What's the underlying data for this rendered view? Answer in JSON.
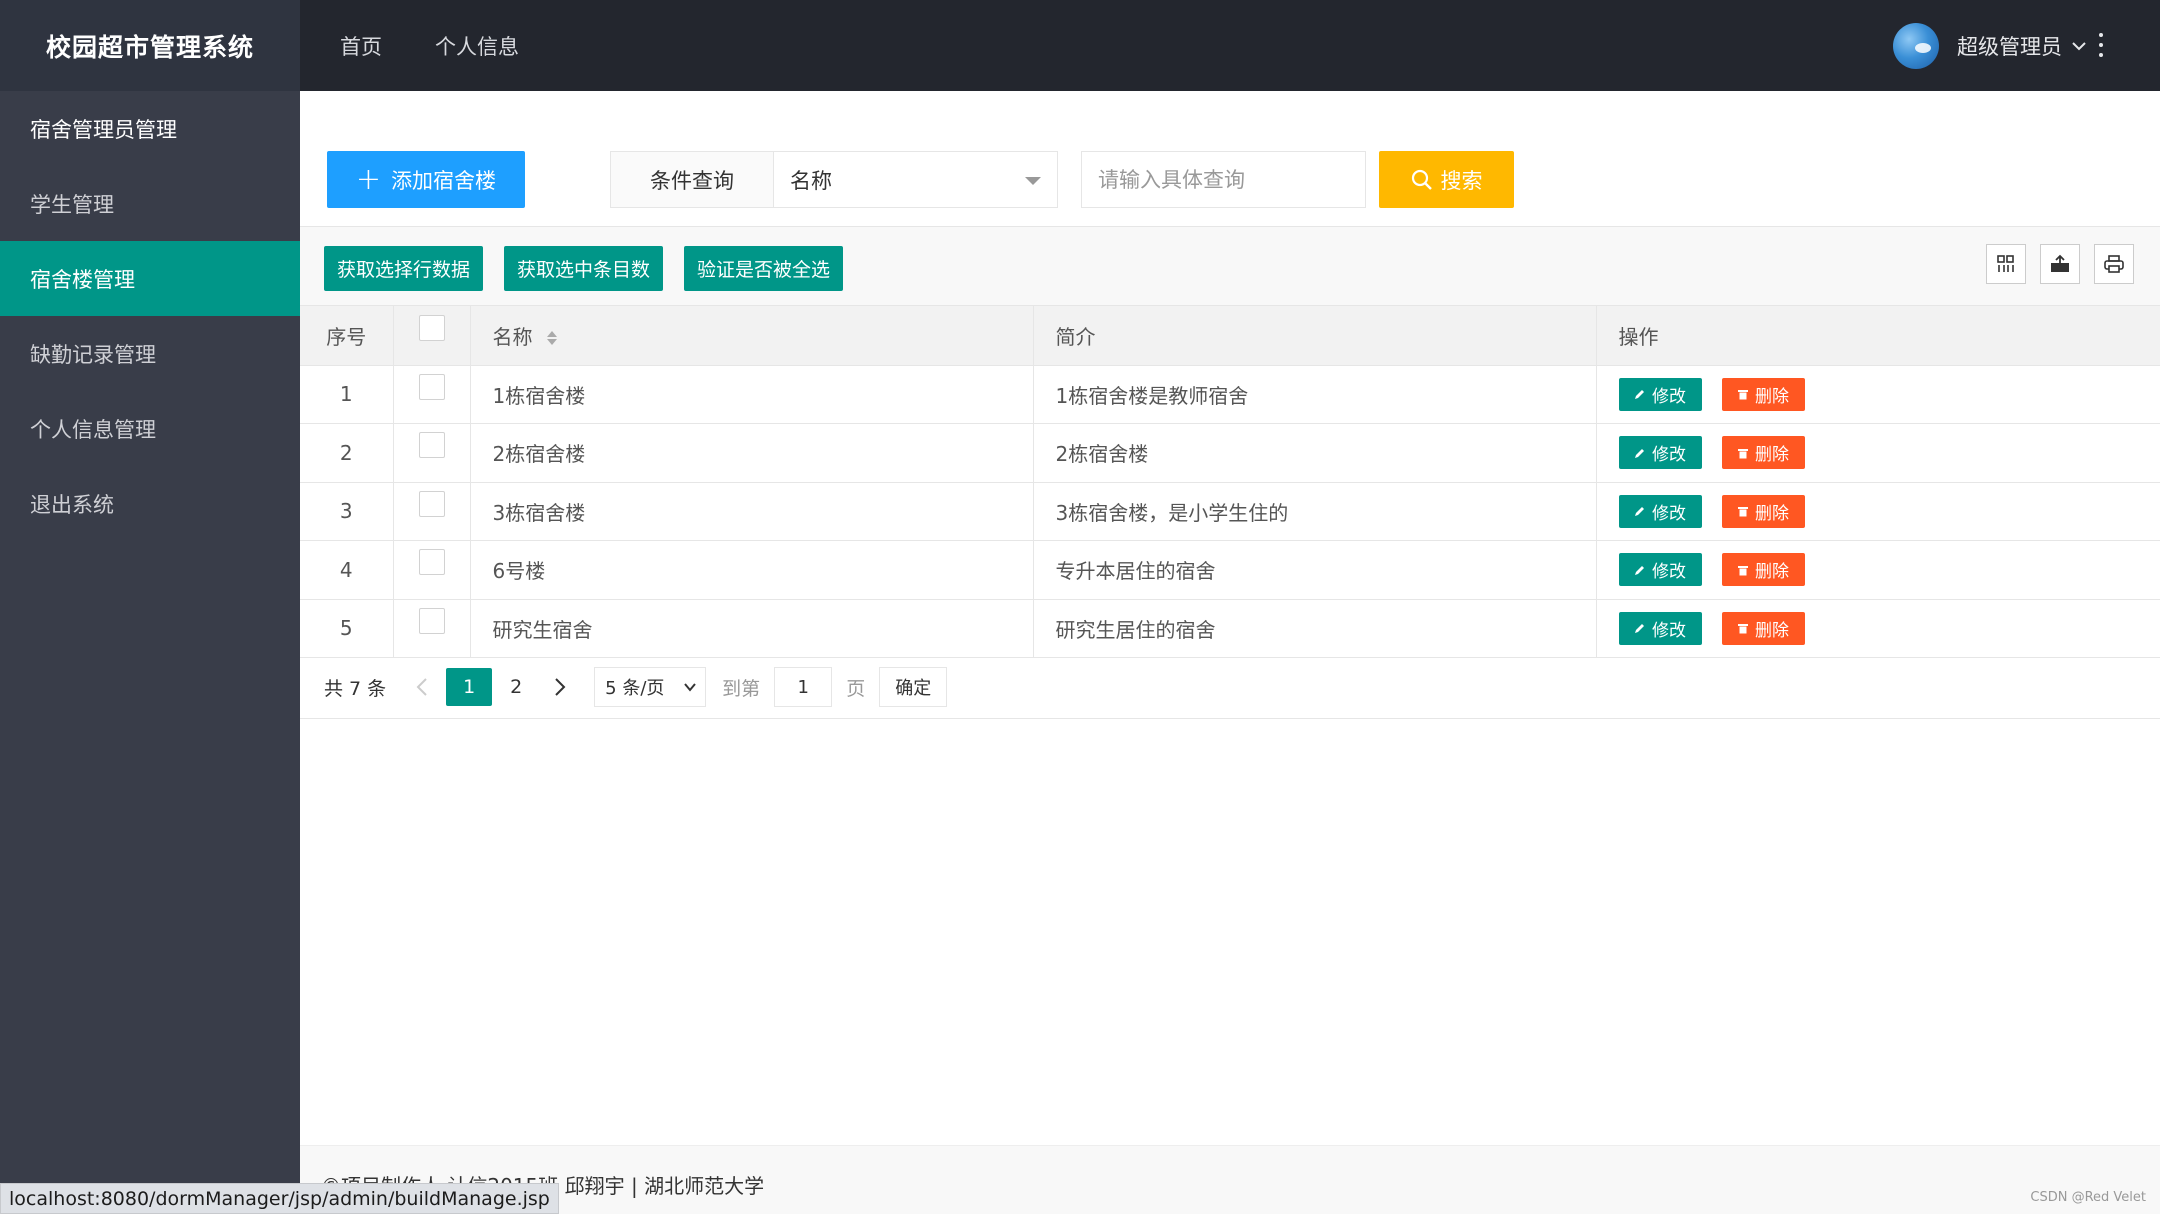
{
  "app_title": "校园超市管理系统",
  "topnav": [
    "首页",
    "个人信息"
  ],
  "user": {
    "name": "超级管理员"
  },
  "sidebar": {
    "items": [
      {
        "label": "宿舍管理员管理",
        "active": false
      },
      {
        "label": "学生管理",
        "active": false
      },
      {
        "label": "宿舍楼管理",
        "active": true
      },
      {
        "label": "缺勤记录管理",
        "active": false
      },
      {
        "label": "个人信息管理",
        "active": false
      },
      {
        "label": "退出系统",
        "active": false
      }
    ]
  },
  "search": {
    "add_label": "添加宿舍楼",
    "condition_label": "条件查询",
    "condition_value": "名称",
    "placeholder": "请输入具体查询",
    "search_label": "搜索"
  },
  "toolbar": {
    "buttons": [
      "获取选择行数据",
      "获取选中条目数",
      "验证是否被全选"
    ],
    "icons": [
      "columns-icon",
      "export-icon",
      "print-icon"
    ]
  },
  "table": {
    "headers": [
      "序号",
      "名称",
      "简介",
      "操作"
    ],
    "rows": [
      {
        "idx": "1",
        "name": "1栋宿舍楼",
        "desc": "1栋宿舍楼是教师宿舍"
      },
      {
        "idx": "2",
        "name": "2栋宿舍楼",
        "desc": "2栋宿舍楼"
      },
      {
        "idx": "3",
        "name": "3栋宿舍楼",
        "desc": "3栋宿舍楼，是小学生住的"
      },
      {
        "idx": "4",
        "name": "6号楼",
        "desc": "专升本居住的宿舍"
      },
      {
        "idx": "5",
        "name": "研究生宿舍",
        "desc": "研究生居住的宿舍"
      }
    ],
    "edit_label": "修改",
    "delete_label": "删除"
  },
  "pager": {
    "total": "共 7 条",
    "pages": [
      "1",
      "2"
    ],
    "current": "1",
    "limit": "5 条/页",
    "goto_label": "到第",
    "goto_value": "1",
    "page_unit": "页",
    "confirm": "确定"
  },
  "footer": "©项目制作人 计信2015班 邱翔宇 | 湖北师范大学",
  "statusbar": "localhost:8080/dormManager/jsp/admin/buildManage.jsp",
  "watermark": "CSDN @Red Velet",
  "colors": {
    "primary": "#009688",
    "blue": "#1e9fff",
    "warm": "#ffb800",
    "danger": "#ff5722",
    "header": "#23262e",
    "sidebar": "#393d49"
  }
}
